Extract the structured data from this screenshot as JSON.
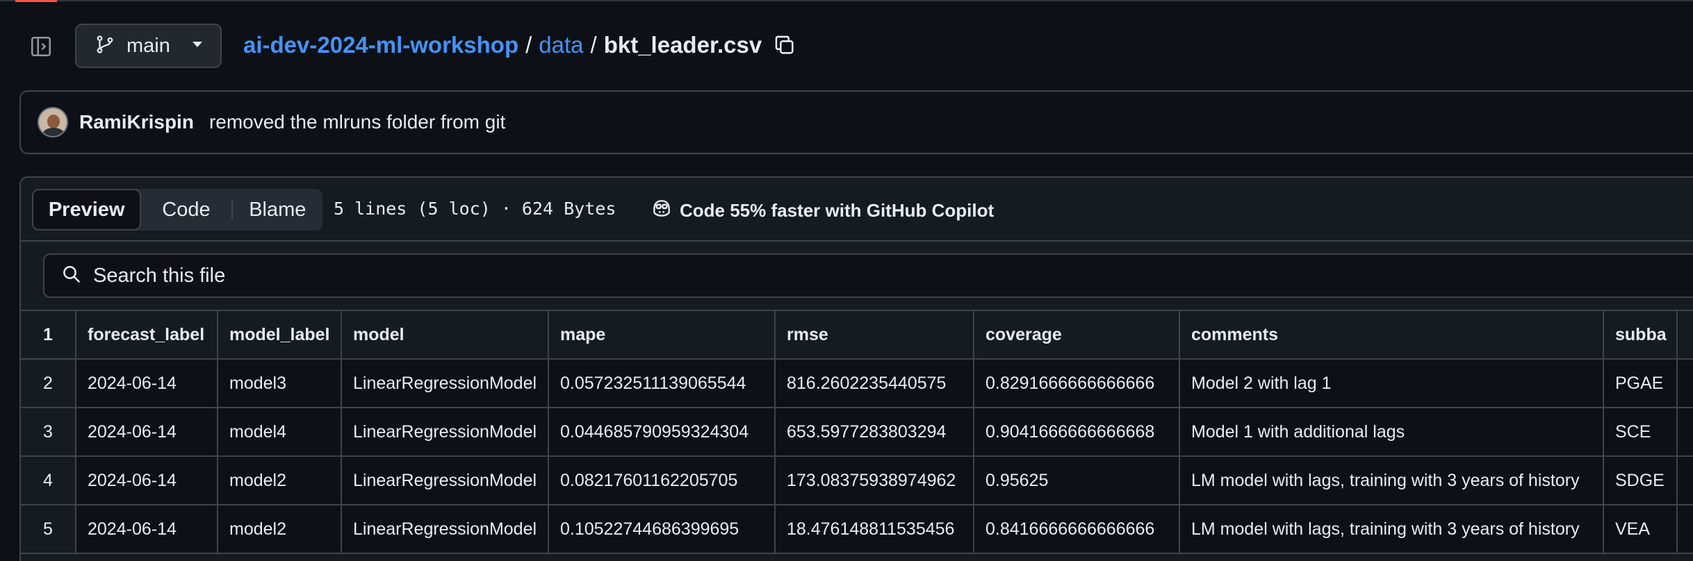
{
  "header": {
    "branch": "main",
    "repo": "ai-dev-2024-ml-workshop",
    "dir": "data",
    "sep": "/",
    "file": "bkt_leader.csv"
  },
  "commit": {
    "author": "RamiKrispin",
    "message": "removed the mlruns folder from git"
  },
  "toolbar": {
    "tabs": [
      "Preview",
      "Code",
      "Blame"
    ],
    "active_tab": "Preview",
    "file_info": "5 lines (5 loc) · 624 Bytes",
    "copilot": "Code 55% faster with GitHub Copilot"
  },
  "search": {
    "placeholder": "Search this file"
  },
  "table": {
    "headers": [
      "forecast_label",
      "model_label",
      "model",
      "mape",
      "rmse",
      "coverage",
      "comments",
      "subba"
    ],
    "header_line": "1",
    "rows": [
      {
        "line": "2",
        "cells": [
          "2024-06-14",
          "model3",
          "LinearRegressionModel",
          "0.057232511139065544",
          "816.2602235440575",
          "0.8291666666666666",
          "Model 2 with lag 1",
          "PGAE"
        ]
      },
      {
        "line": "3",
        "cells": [
          "2024-06-14",
          "model4",
          "LinearRegressionModel",
          "0.044685790959324304",
          "653.5977283803294",
          "0.9041666666666668",
          "Model 1 with additional lags",
          "SCE"
        ]
      },
      {
        "line": "4",
        "cells": [
          "2024-06-14",
          "model2",
          "LinearRegressionModel",
          "0.08217601162205705",
          "173.08375938974962",
          "0.95625",
          "LM model with lags, training with 3 years of history",
          "SDGE"
        ]
      },
      {
        "line": "5",
        "cells": [
          "2024-06-14",
          "model2",
          "LinearRegressionModel",
          "0.10522744686399695",
          "18.476148811535456",
          "0.8416666666666666",
          "LM model with lags, training with 3 years of history",
          "VEA"
        ]
      }
    ]
  },
  "colors": {
    "background": "#0d1117",
    "link": "#4493f8",
    "border": "#3d444d",
    "accent": "#f85149"
  }
}
